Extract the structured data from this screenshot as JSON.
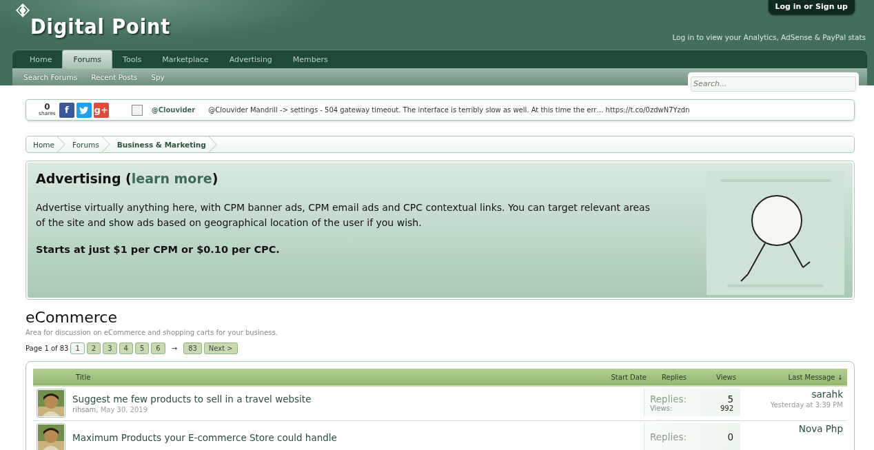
{
  "header": {
    "logo_text": "Digital Point",
    "login_button": "Log in or Sign up",
    "stats_link": "Log in to view your Analytics, AdSense & PayPal stats"
  },
  "tabs": [
    {
      "label": "Home",
      "selected": false
    },
    {
      "label": "Forums",
      "selected": true
    },
    {
      "label": "Tools",
      "selected": false
    },
    {
      "label": "Marketplace",
      "selected": false
    },
    {
      "label": "Advertising",
      "selected": false
    },
    {
      "label": "Members",
      "selected": false
    }
  ],
  "subnav": [
    "Search Forums",
    "Recent Posts",
    "Spy"
  ],
  "search": {
    "placeholder": "Search..."
  },
  "share_bar": {
    "count": "0",
    "count_label": "shares",
    "buttons": [
      {
        "kind": "facebook",
        "label": "f"
      },
      {
        "kind": "twitter"
      },
      {
        "kind": "googleplus",
        "label": "g+"
      }
    ],
    "tweet_user": "@Clouvider",
    "tweet_text": "@Clouvider Mandrill -> settings - 504 gateway timeout. The interface is terribly slow as well. At this time the err… https://t.co/0zdwN7Yzdn"
  },
  "breadcrumbs": [
    {
      "label": "Home",
      "current": false
    },
    {
      "label": "Forums",
      "current": false
    },
    {
      "label": "Business & Marketing",
      "current": true
    }
  ],
  "ad": {
    "title": "Advertising (",
    "link": "learn more",
    "title_end": ")",
    "text": "Advertise virtually anything here, with CPM banner ads, CPM email ads and CPC contextual links. You can target relevant areas of the site and show ads based on geographical location of the user if you wish.",
    "price": "Starts at just $1 per CPM or $0.10 per CPC."
  },
  "forum": {
    "title": "eCommerce",
    "description": "Area for discussion on eCommerce and shopping carts for your business.",
    "pager": {
      "label": "Page 1 of 83",
      "pages": [
        {
          "label": "1",
          "selected": true
        },
        {
          "label": "2",
          "selected": false
        },
        {
          "label": "3",
          "selected": false
        },
        {
          "label": "4",
          "selected": false
        },
        {
          "label": "5",
          "selected": false
        },
        {
          "label": "6",
          "selected": false
        }
      ],
      "skip": "→",
      "last": "83",
      "next": "Next >"
    },
    "columns": [
      "Title",
      "Start Date",
      "Replies",
      "Views",
      "Last Message ↓"
    ],
    "threads": [
      {
        "title": "Suggest me few products to sell in a travel website",
        "author": "rihsam,",
        "date": "May 30, 2019",
        "replies_label": "Replies:",
        "replies": "5",
        "views_label": "Views:",
        "views": "992",
        "last_user": "sarahk",
        "last_time": "Yesterday at 3:39 PM"
      },
      {
        "title": "Maximum Products your E-commerce Store could handle",
        "replies_label": "Replies:",
        "replies": "0",
        "last_user": "Nova Php"
      }
    ]
  }
}
